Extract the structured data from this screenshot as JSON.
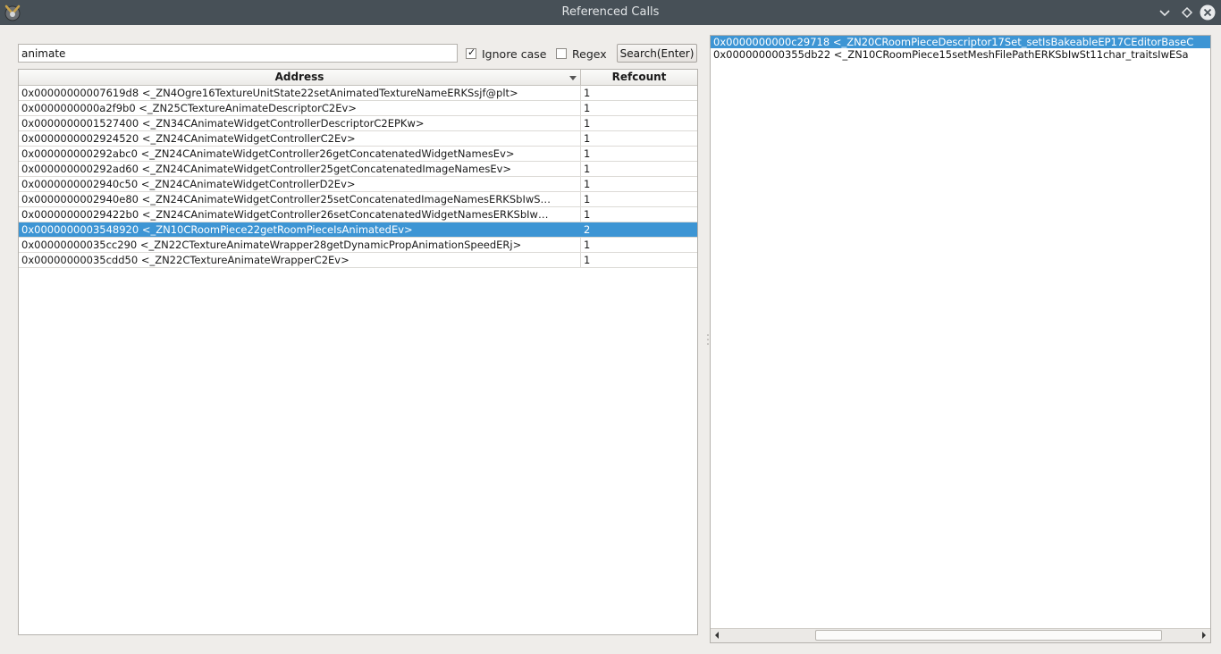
{
  "window": {
    "title": "Referenced Calls",
    "controls": [
      "chevron-down-icon",
      "diamond-icon",
      "close-icon"
    ]
  },
  "search": {
    "value": "animate",
    "ignore_case_label": "Ignore case",
    "ignore_case_checked": true,
    "regex_label": "Regex",
    "regex_checked": false,
    "button_label": "Search(Enter)"
  },
  "table": {
    "columns": [
      "Address",
      "Refcount"
    ],
    "rows": [
      {
        "address": "0x00000000007619d8 <_ZN4Ogre16TextureUnitState22setAnimatedTextureNameERKSsjf@plt>",
        "refcount": "1"
      },
      {
        "address": "0x0000000000a2f9b0 <_ZN25CTextureAnimateDescriptorC2Ev>",
        "refcount": "1"
      },
      {
        "address": "0x0000000001527400 <_ZN34CAnimateWidgetControllerDescriptorC2EPKw>",
        "refcount": "1"
      },
      {
        "address": "0x0000000002924520 <_ZN24CAnimateWidgetControllerC2Ev>",
        "refcount": "1"
      },
      {
        "address": "0x000000000292abc0 <_ZN24CAnimateWidgetController26getConcatenatedWidgetNamesEv>",
        "refcount": "1"
      },
      {
        "address": "0x000000000292ad60 <_ZN24CAnimateWidgetController25getConcatenatedImageNamesEv>",
        "refcount": "1"
      },
      {
        "address": "0x0000000002940c50 <_ZN24CAnimateWidgetControllerD2Ev>",
        "refcount": "1"
      },
      {
        "address": "0x0000000002940e80 <_ZN24CAnimateWidgetController25setConcatenatedImageNamesERKSbIwS…",
        "refcount": "1"
      },
      {
        "address": "0x00000000029422b0 <_ZN24CAnimateWidgetController26setConcatenatedWidgetNamesERKSbIw…",
        "refcount": "1"
      },
      {
        "address": "0x0000000003548920 <_ZN10CRoomPiece22getRoomPieceIsAnimatedEv>",
        "refcount": "2"
      },
      {
        "address": "0x00000000035cc290 <_ZN22CTextureAnimateWrapper28getDynamicPropAnimationSpeedERj>",
        "refcount": "1"
      },
      {
        "address": "0x00000000035cdd50 <_ZN22CTextureAnimateWrapperC2Ev>",
        "refcount": "1"
      }
    ],
    "selected_index": 9
  },
  "refs": {
    "items": [
      "0x0000000000c29718 <_ZN20CRoomPieceDescriptor17Set_setIsBakeableEP17CEditorBaseC",
      "0x000000000355db22 <_ZN10CRoomPiece15setMeshFilePathERKSbIwSt11char_traitsIwESa"
    ],
    "selected_index": 0,
    "scroll_fraction": 0.72
  }
}
